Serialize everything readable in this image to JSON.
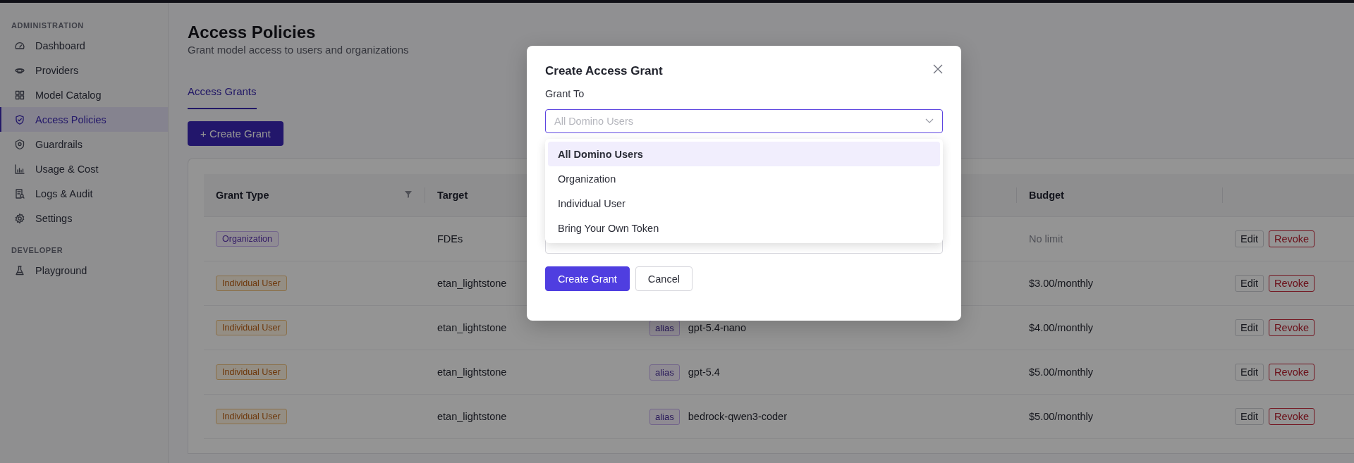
{
  "sidebar": {
    "sections": [
      {
        "title": "ADMINISTRATION",
        "items": [
          {
            "label": "Dashboard",
            "selected": false
          },
          {
            "label": "Providers",
            "selected": false
          },
          {
            "label": "Model Catalog",
            "selected": false
          },
          {
            "label": "Access Policies",
            "selected": true
          },
          {
            "label": "Guardrails",
            "selected": false
          },
          {
            "label": "Usage & Cost",
            "selected": false
          },
          {
            "label": "Logs & Audit",
            "selected": false
          },
          {
            "label": "Settings",
            "selected": false
          }
        ]
      },
      {
        "title": "DEVELOPER",
        "items": [
          {
            "label": "Playground",
            "selected": false
          }
        ]
      }
    ]
  },
  "page": {
    "title": "Access Policies",
    "subtitle": "Grant model access to users and organizations"
  },
  "tabs": [
    {
      "label": "Access Grants",
      "selected": true
    }
  ],
  "create_button": "+ Create Grant",
  "table": {
    "columns": [
      {
        "label": "Grant Type",
        "filter": true
      },
      {
        "label": "Target",
        "filter": false
      },
      {
        "label": "Budget",
        "filter": false
      }
    ],
    "rows": [
      {
        "grant_type": {
          "label": "Organization",
          "kind": "organization"
        },
        "target": "FDEs",
        "budget": "No limit",
        "budget_muted": true,
        "actions": [
          "Edit",
          "Revoke"
        ]
      },
      {
        "grant_type": {
          "label": "Individual User",
          "kind": "individual"
        },
        "target": "etan_lightstone",
        "budget": "$3.00/monthly",
        "budget_muted": false,
        "actions": [
          "Edit",
          "Revoke"
        ]
      },
      {
        "grant_type": {
          "label": "Individual User",
          "kind": "individual"
        },
        "target": "etan_lightstone",
        "model": {
          "tag": "alias",
          "name": "gpt-5.4-nano"
        },
        "budget": "$4.00/monthly",
        "budget_muted": false,
        "actions": [
          "Edit",
          "Revoke"
        ]
      },
      {
        "grant_type": {
          "label": "Individual User",
          "kind": "individual"
        },
        "target": "etan_lightstone",
        "model": {
          "tag": "alias",
          "name": "gpt-5.4"
        },
        "budget": "$5.00/monthly",
        "budget_muted": false,
        "actions": [
          "Edit",
          "Revoke"
        ]
      },
      {
        "grant_type": {
          "label": "Individual User",
          "kind": "individual"
        },
        "target": "etan_lightstone",
        "model": {
          "tag": "alias",
          "name": "bedrock-qwen3-coder"
        },
        "budget": "$5.00/monthly",
        "budget_muted": false,
        "actions": [
          "Edit",
          "Revoke"
        ]
      }
    ]
  },
  "modal": {
    "title": "Create Access Grant",
    "grant_to": {
      "label": "Grant To",
      "placeholder": "All Domino Users"
    },
    "options": [
      {
        "label": "All Domino Users",
        "selected": true
      },
      {
        "label": "Organization",
        "selected": false
      },
      {
        "label": "Individual User",
        "selected": false
      },
      {
        "label": "Bring Your Own Token",
        "selected": false
      }
    ],
    "buttons": [
      {
        "label": "Create Grant",
        "kind": "primary"
      },
      {
        "label": "Cancel",
        "kind": "secondary"
      }
    ]
  }
}
